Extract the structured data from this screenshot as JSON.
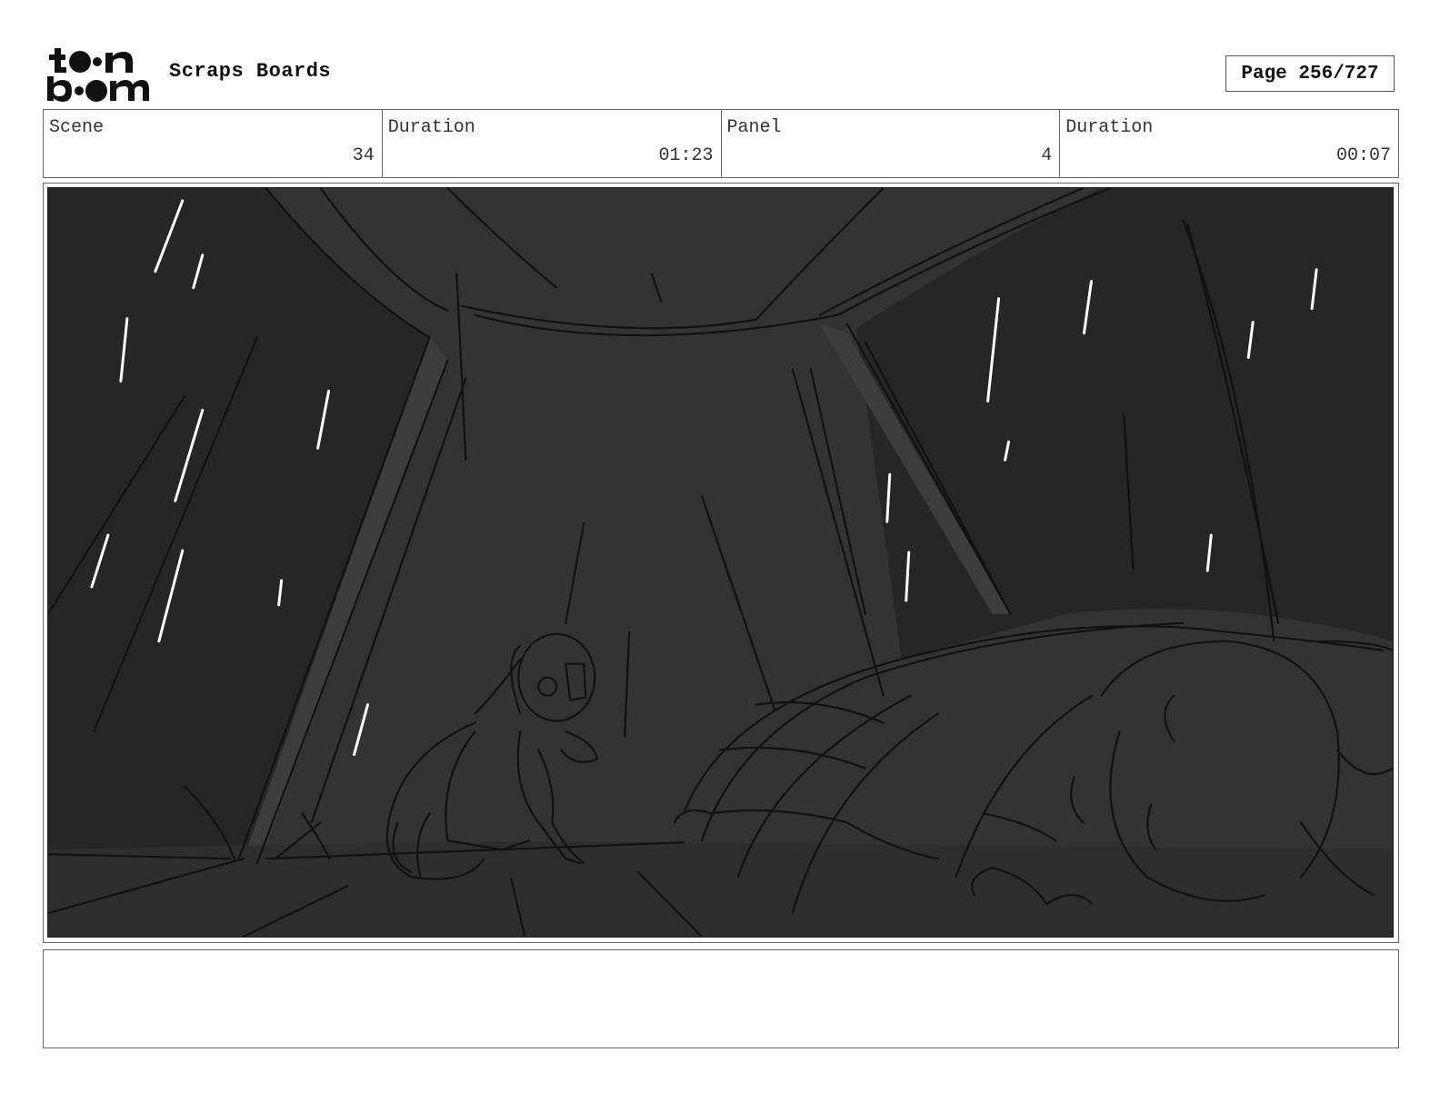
{
  "header": {
    "logo_text": "toon boom",
    "board_title": "Scraps Boards",
    "page_label": "Page 256/727"
  },
  "info": [
    {
      "label": "Scene",
      "value": "34"
    },
    {
      "label": "Duration",
      "value": "01:23"
    },
    {
      "label": "Panel",
      "value": "4"
    },
    {
      "label": "Duration",
      "value": "00:07"
    }
  ],
  "panel": {
    "icon": "storyboard-sketch-image",
    "colors": {
      "background": "#333333",
      "shadow": "#262626",
      "highlight": "#3d3d3d",
      "rain": "#ffffff",
      "line": "#111111"
    }
  },
  "notes": {
    "text": ""
  }
}
